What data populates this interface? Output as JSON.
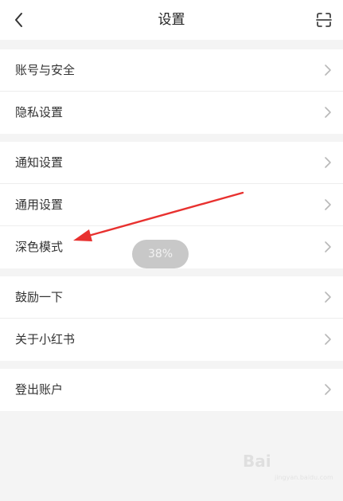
{
  "header": {
    "title": "设置",
    "back_icon": "chevron-left-icon",
    "scan_icon": "scan-icon"
  },
  "groups": [
    {
      "items": [
        {
          "label": "账号与安全"
        },
        {
          "label": "隐私设置"
        }
      ]
    },
    {
      "items": [
        {
          "label": "通知设置"
        },
        {
          "label": "通用设置"
        },
        {
          "label": "深色模式"
        }
      ]
    },
    {
      "items": [
        {
          "label": "鼓励一下"
        },
        {
          "label": "关于小红书"
        }
      ]
    },
    {
      "items": [
        {
          "label": "登出账户"
        }
      ]
    }
  ],
  "toast": {
    "text": "38%"
  },
  "annotation": {
    "color": "#e8312f"
  },
  "watermark": {
    "text": "Bai",
    "sub": "jingyan.baidu.com"
  },
  "colors": {
    "background": "#f4f4f4",
    "card": "#ffffff",
    "text": "#333333",
    "chevron": "#b8b8b8"
  }
}
